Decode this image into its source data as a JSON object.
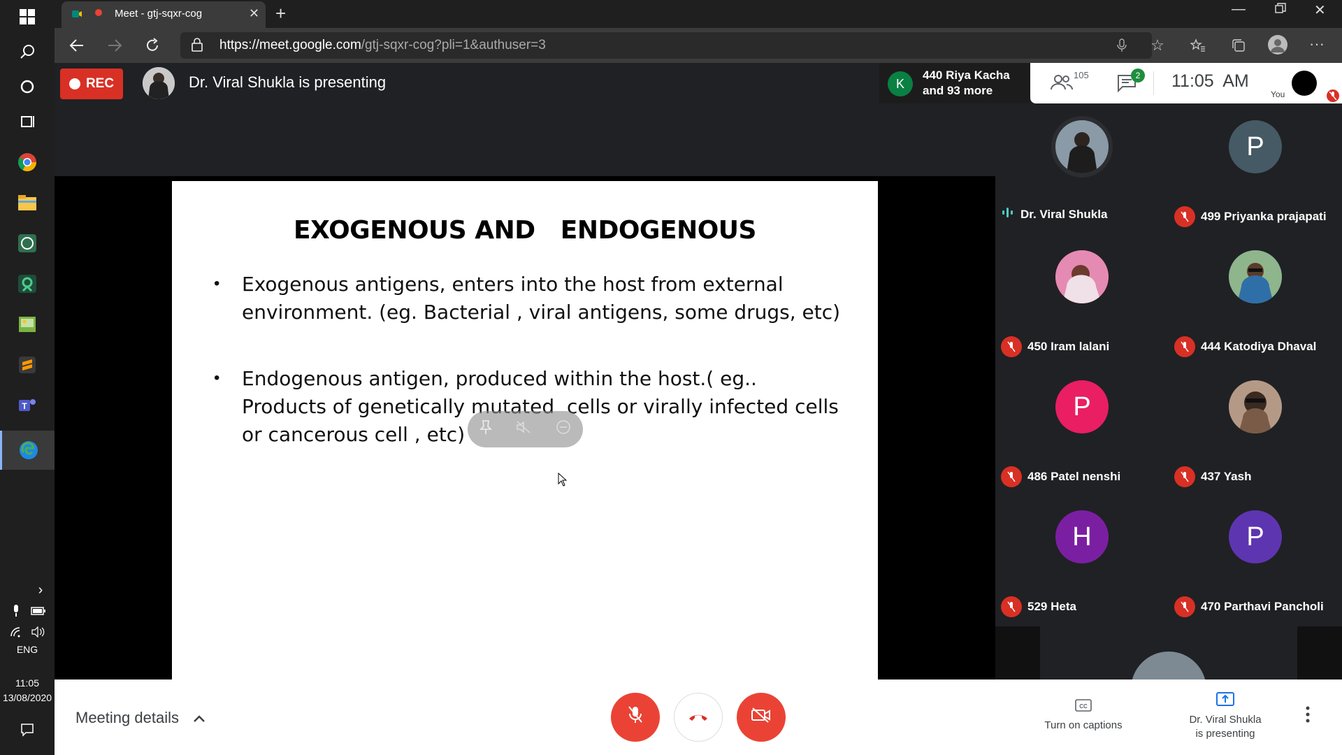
{
  "browser": {
    "tab_title": "Meet - gtj-sqxr-cog",
    "url_domain": "https://meet.google.com",
    "url_path": "/gtj-sqxr-cog?pli=1&authuser=3"
  },
  "meet_header": {
    "rec_label": "REC",
    "presenting_text": "Dr. Viral Shukla is presenting",
    "joined_avatar_letter": "K",
    "joined_line1": "440 Riya Kacha",
    "joined_line2": "and 93 more",
    "people_count": "105",
    "chat_count": "2",
    "time": "11:05  AM",
    "you_label": "You"
  },
  "slide": {
    "title": "EXOGENOUS AND   ENDOGENOUS",
    "bullets": [
      "Exogenous antigens, enters into the host from external environment. (eg. Bacterial , viral antigens, some drugs, etc)",
      "Endogenous antigen, produced within the host.( eg.. Products of genetically mutated  cells or virally infected cells or cancerous cell , etc)"
    ]
  },
  "participants": [
    {
      "name": "Dr. Viral Shukla",
      "avatar": "",
      "color": "#3c4043",
      "muted": false
    },
    {
      "name": "499 Priyanka prajapati",
      "avatar": "P",
      "color": "#455a64",
      "muted": true
    },
    {
      "name": "450 Iram lalani",
      "avatar": "",
      "color": "#c2185b",
      "muted": true
    },
    {
      "name": "444 Katodiya Dhaval",
      "avatar": "",
      "color": "#1976d2",
      "muted": true
    },
    {
      "name": "486 Patel nenshi",
      "avatar": "P",
      "color": "#e91e63",
      "muted": true
    },
    {
      "name": "437 Yash",
      "avatar": "",
      "color": "#795548",
      "muted": true
    },
    {
      "name": "529 Heta",
      "avatar": "H",
      "color": "#7b1fa2",
      "muted": true
    },
    {
      "name": "470 Parthavi Pancholi",
      "avatar": "P",
      "color": "#5e35b1",
      "muted": true
    }
  ],
  "bottom_bar": {
    "meeting_details": "Meeting details",
    "captions_label": "Turn on captions",
    "presenting_label_1": "Dr. Viral Shukla",
    "presenting_label_2": "is presenting"
  },
  "taskbar": {
    "lang": "ENG",
    "time": "11:05",
    "date": "13/08/2020"
  },
  "colors": {
    "rec": "#d93025",
    "mute_red": "#ea4335",
    "meet_bg": "#202124"
  }
}
